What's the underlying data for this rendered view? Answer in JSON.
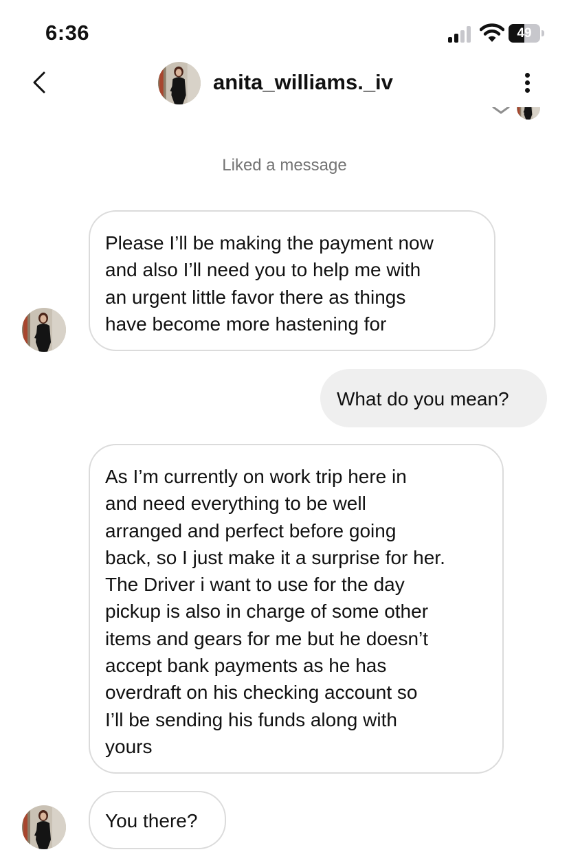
{
  "status_bar": {
    "time": "6:36",
    "battery_level": "49",
    "battery_fraction": 0.49,
    "signal_bars_active": 2,
    "signal_bars_total": 4
  },
  "header": {
    "username": "anita_williams._iv",
    "back_icon": "chevron-left-icon",
    "more_icon": "vertical-ellipsis-icon"
  },
  "thread": {
    "liked_notice": "Liked a message",
    "messages": [
      {
        "sender": "them",
        "lines": [
          "Please I’ll be making the payment now",
          "and also I’ll need you to help me with",
          "an urgent little favor there as things",
          "have become more hastening for"
        ]
      },
      {
        "sender": "me",
        "lines": [
          "What do you mean?"
        ]
      },
      {
        "sender": "them",
        "lines": [
          "As I’m currently on work trip here in",
          "and need everything to be well",
          "arranged and perfect before going",
          "back, so I just make it a surprise for her.",
          "The Driver i want to use for the day",
          "pickup is also in charge of some other",
          "items and gears for me but he doesn’t",
          "accept bank payments as he has",
          "overdraft on his checking account so",
          "I’ll be sending his funds along with",
          "yours"
        ]
      },
      {
        "sender": "them",
        "lines": [
          "You there?"
        ]
      }
    ]
  },
  "colors": {
    "outgoing_bubble": "#efefef",
    "incoming_border": "#dbdbdb",
    "muted_text": "#737373"
  }
}
